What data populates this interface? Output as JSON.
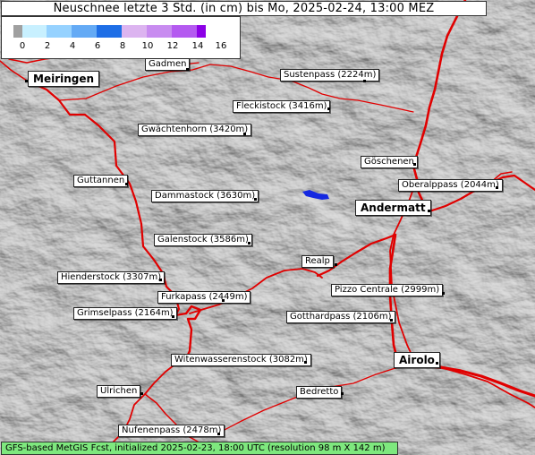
{
  "title": "Neuschnee letzte 3 Std. (in cm) bis Mo, 2025-02-24, 13:00 MEZ",
  "legend": {
    "ticks": [
      "0",
      "2",
      "4",
      "6",
      "8",
      "10",
      "12",
      "14",
      "16"
    ],
    "colors": [
      "#a0a0a0",
      "#c8f0ff",
      "#96d2ff",
      "#64aaf5",
      "#1e6ee6",
      "#dcb4f0",
      "#c88cf0",
      "#b45af0",
      "#8c00e6"
    ]
  },
  "places": {
    "meiringen": "Meiringen",
    "gadmen": "Gadmen",
    "sustenpass": "Sustenpass (2224m)",
    "fleckistock": "Fleckistock (3416m)",
    "gwaechtenhorn": "Gwächtenhorn (3420m)",
    "goeschenen": "Göschenen",
    "guttannen": "Guttannen",
    "oberalppass": "Oberalppass (2044m)",
    "dammastock": "Dammastock (3630m)",
    "andermatt": "Andermatt",
    "galenstock": "Galenstock (3586m)",
    "realp": "Realp",
    "hienderstock": "Hienderstock (3307m)",
    "pizzo_centrale": "Pizzo Centrale (2999m)",
    "furkapass": "Furkapass (2449m)",
    "grimselpass": "Grimselpass (2164m)",
    "gotthardpass": "Gotthardpass (2106m)",
    "airolo": "Airolo",
    "witenwasserenstock": "Witenwasserenstock (3082m)",
    "ulrichen": "Ulrichen",
    "bedretto": "Bedretto",
    "nufenenpass": "Nufenenpass (2478m)"
  },
  "footer": "GFS-based MetGIS Fcst, initialized 2025-02-23, 18:00 UTC  (resolution 98 m X 142 m)",
  "colors": {
    "roads": "#e00000",
    "snow_patch": "#1428e0",
    "terrain": "#8c8c8c",
    "footer_bg": "#7ee87e"
  }
}
